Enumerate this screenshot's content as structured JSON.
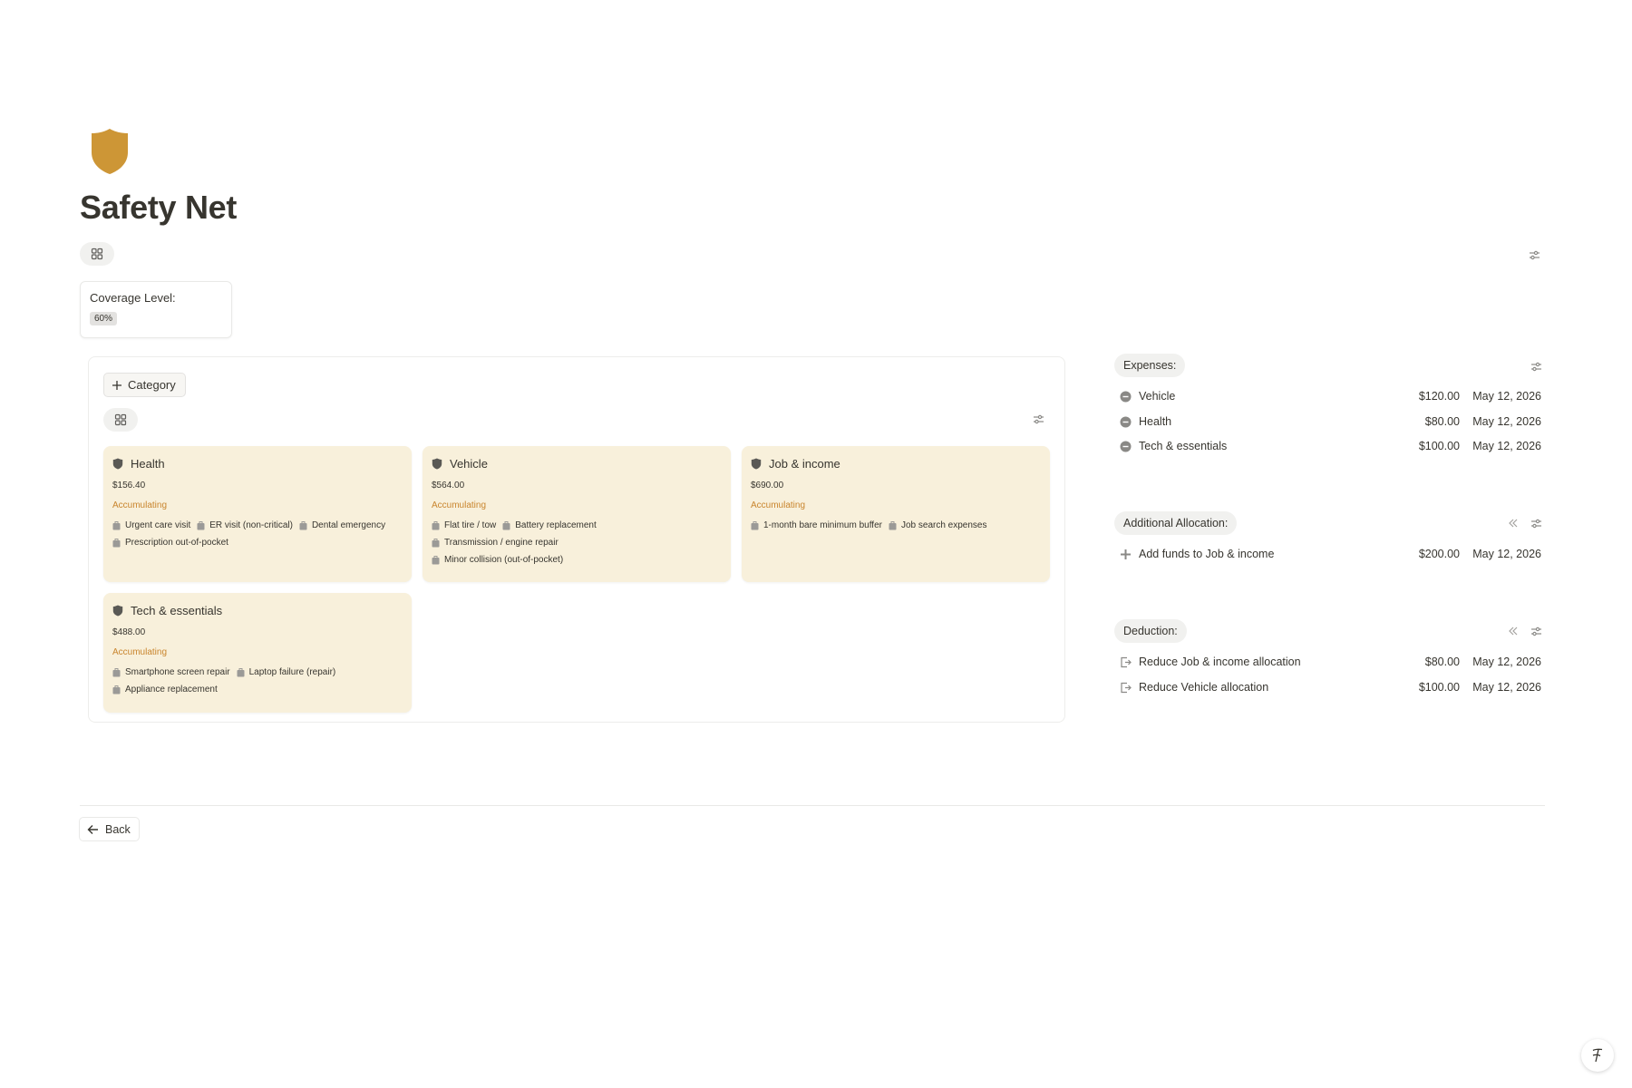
{
  "page": {
    "title": "Safety Net",
    "icon": "shield-icon",
    "icon_color": "#cd9636"
  },
  "coverage": {
    "label": "Coverage Level:",
    "value": "60%"
  },
  "board": {
    "add_label": "Category",
    "cards": [
      {
        "title": "Health",
        "amount": "$156.40",
        "status": "Accumulating",
        "items": [
          "Urgent care visit",
          "ER visit (non-critical)",
          "Dental emergency",
          "Prescription out-of-pocket"
        ]
      },
      {
        "title": "Vehicle",
        "amount": "$564.00",
        "status": "Accumulating",
        "items": [
          "Flat tire / tow",
          "Battery replacement",
          "Transmission / engine repair",
          "Minor collision (out-of-pocket)"
        ]
      },
      {
        "title": "Job & income",
        "amount": "$690.00",
        "status": "Accumulating",
        "items": [
          "1-month bare minimum buffer",
          "Job search expenses"
        ]
      },
      {
        "title": "Tech & essentials",
        "amount": "$488.00",
        "status": "Accumulating",
        "items": [
          "Smartphone screen repair",
          "Laptop failure (repair)",
          "Appliance replacement"
        ]
      }
    ]
  },
  "expenses": {
    "label": "Expenses:",
    "rows": [
      {
        "name": "Vehicle",
        "amount": "$120.00",
        "date": "May 12, 2026",
        "icon": "minus-circle-icon"
      },
      {
        "name": "Health",
        "amount": "$80.00",
        "date": "May 12, 2026",
        "icon": "minus-circle-icon"
      },
      {
        "name": "Tech & essentials",
        "amount": "$100.00",
        "date": "May 12, 2026",
        "icon": "minus-circle-icon"
      }
    ]
  },
  "allocation": {
    "label": "Additional Allocation:",
    "rows": [
      {
        "name": "Add funds to Job & income",
        "amount": "$200.00",
        "date": "May 12, 2026",
        "icon": "plus-icon"
      }
    ]
  },
  "deduction": {
    "label": "Deduction:",
    "rows": [
      {
        "name": "Reduce Job & income allocation",
        "amount": "$80.00",
        "date": "May 12, 2026",
        "icon": "export-icon"
      },
      {
        "name": "Reduce Vehicle allocation",
        "amount": "$100.00",
        "date": "May 12, 2026",
        "icon": "export-icon"
      }
    ]
  },
  "footer": {
    "back_label": "Back"
  },
  "colors": {
    "card_bg": "#f8f0db",
    "status": "#c9852d",
    "chip_bg": "#f1f1ef"
  }
}
